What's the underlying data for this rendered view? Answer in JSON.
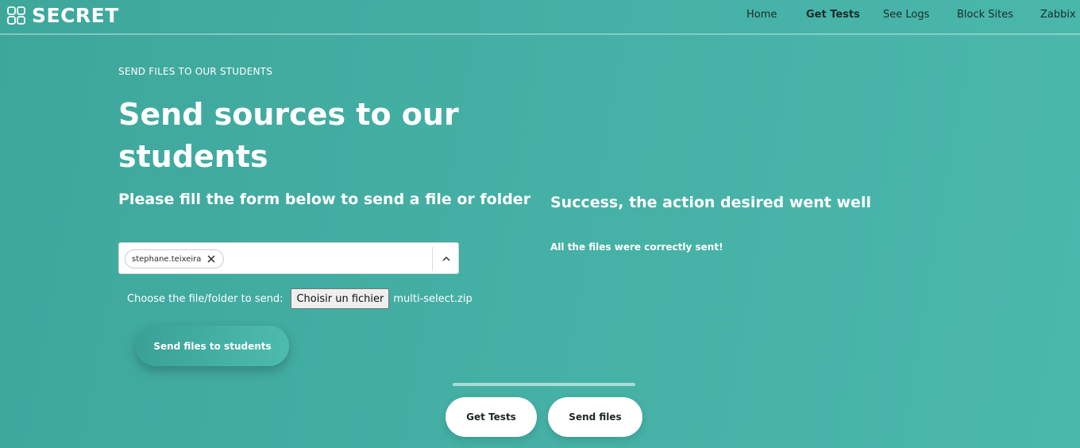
{
  "brand": {
    "name": "SECRET",
    "icon": "grid-icon"
  },
  "nav": {
    "links": [
      {
        "label": "Home",
        "active": false
      },
      {
        "label": "Get Tests",
        "active": true
      },
      {
        "label": "See Logs",
        "active": false
      },
      {
        "label": "Block Sites",
        "active": false
      },
      {
        "label": "Zabbix",
        "active": false
      }
    ]
  },
  "hero": {
    "eyebrow": "SEND FILES TO OUR STUDENTS",
    "title": "Send sources to our students",
    "subtitle": "Please fill the form below to send a file or folder"
  },
  "form": {
    "selected_students": [
      "stephane.teixeira"
    ],
    "file_label": "Choose the file/folder to send:",
    "file_button": "Choisir un fichier",
    "file_name": "multi-select.zip",
    "submit_label": "Send files to students"
  },
  "result": {
    "title": "Success, the action desired went well",
    "message": "All the files were correctly sent!"
  },
  "bottom_buttons": [
    "Get Tests",
    "Send files"
  ],
  "colors": {
    "background": "#45b0a5",
    "text": "#ffffff",
    "nav_text": "#1b2b2a"
  }
}
